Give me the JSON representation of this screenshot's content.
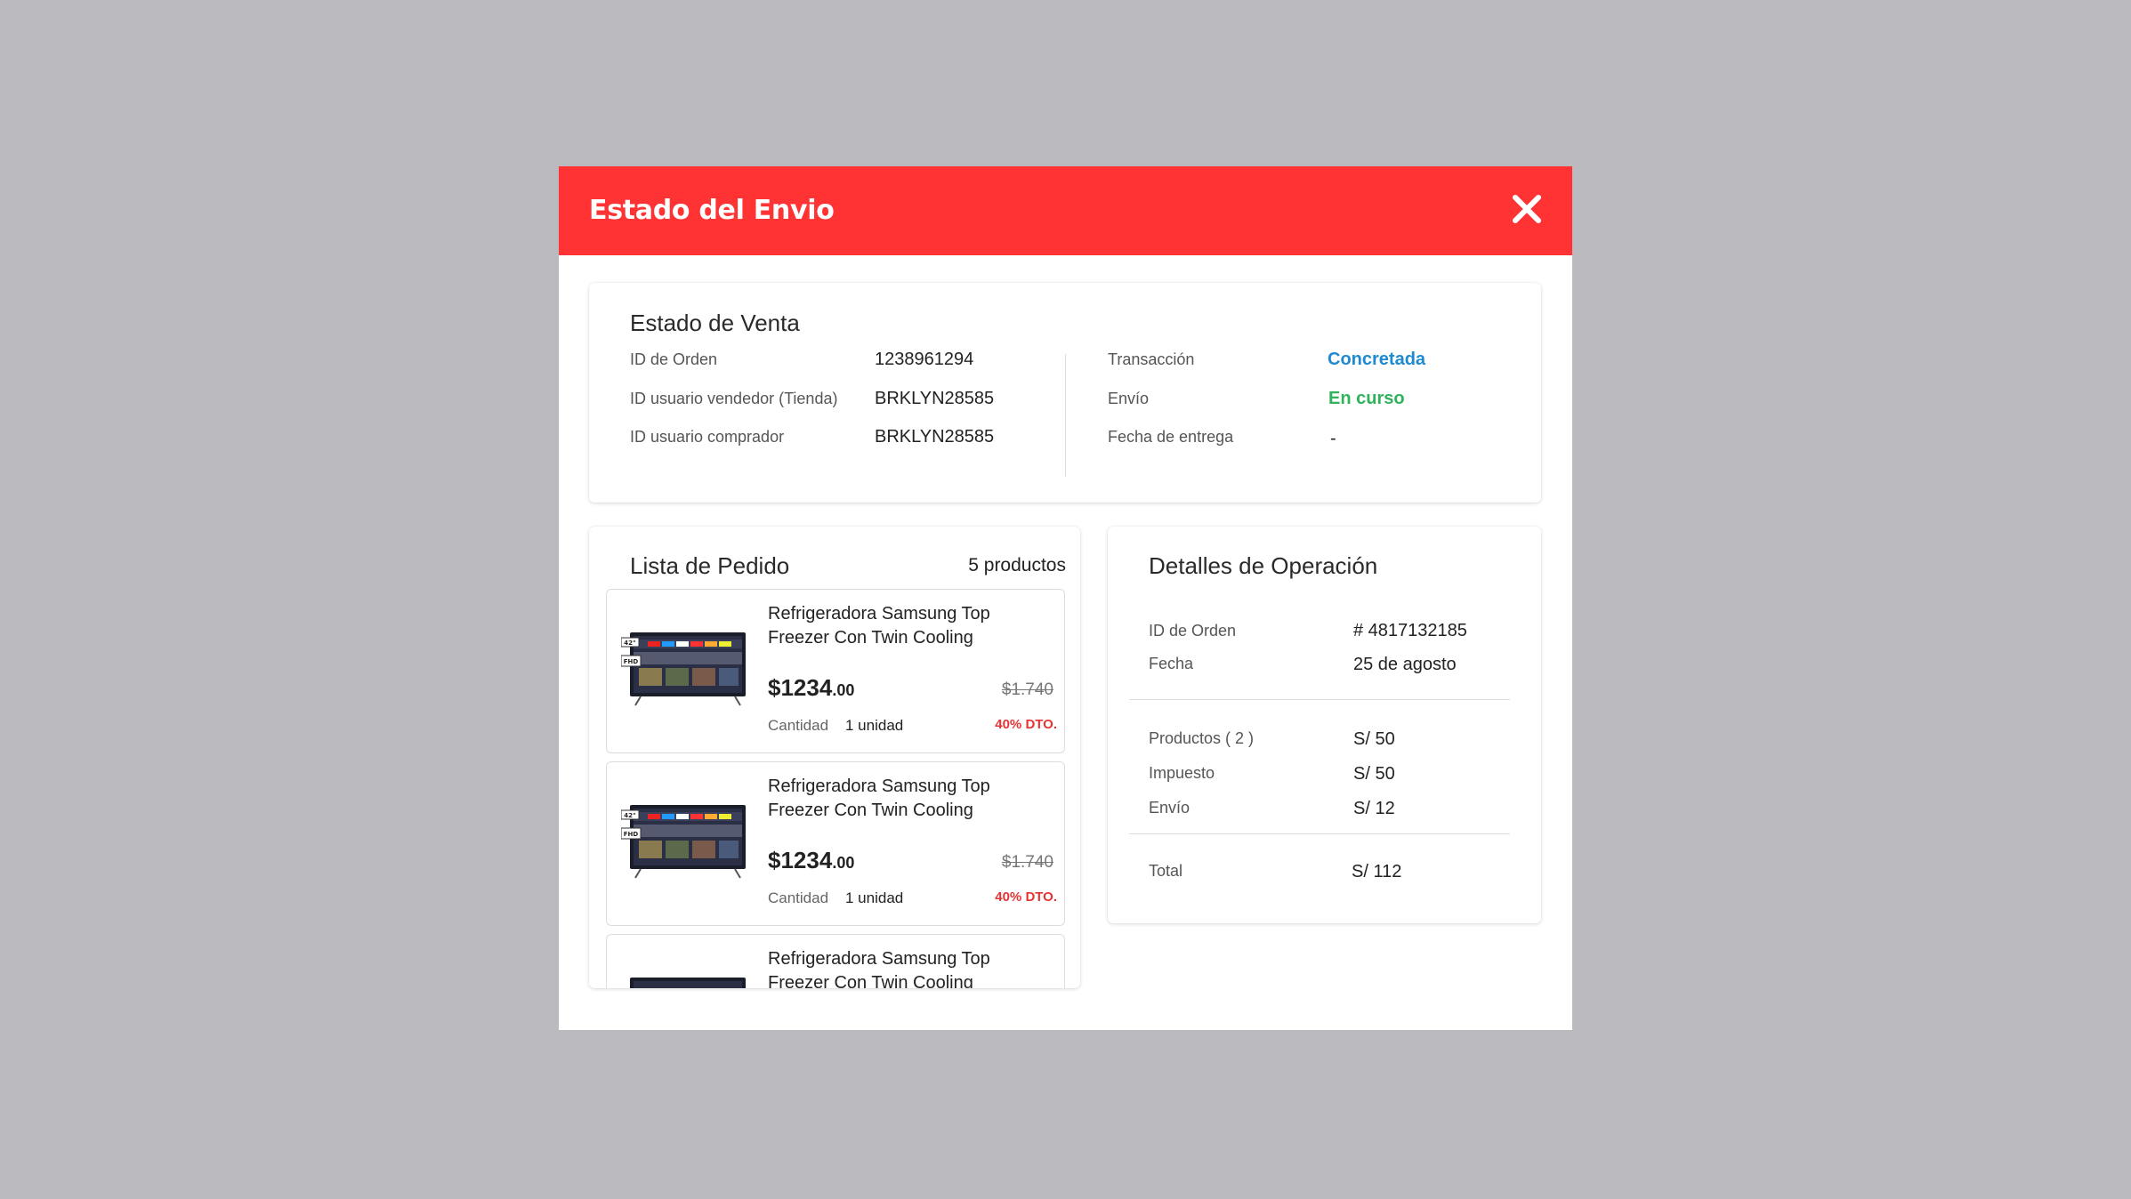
{
  "modal": {
    "title": "Estado del Envio",
    "close_icon": "close-icon"
  },
  "estado_venta": {
    "title": "Estado de Venta",
    "left": [
      {
        "label": "ID de Orden",
        "value": "1238961294"
      },
      {
        "label": "ID usuario vendedor (Tienda)",
        "value": "BRKLYN28585"
      },
      {
        "label": "ID usuario comprador",
        "value": "BRKLYN28585"
      }
    ],
    "right": [
      {
        "label": "Transacción",
        "value": "Concretada",
        "color": "#1e8ad0"
      },
      {
        "label": "Envío",
        "value": "En curso",
        "color": "#2fb35a"
      },
      {
        "label": "Fecha de entrega",
        "value": "-"
      }
    ]
  },
  "lista_pedido": {
    "title": "Lista de Pedido",
    "count": "5 productos",
    "items": [
      {
        "name": "Refrigeradora Samsung Top Freezer Con Twin Cooling",
        "price_int": "$1234",
        "price_dec": ".00",
        "old_price": "$1.740",
        "qty_label": "Cantidad",
        "qty_value": "1 unidad",
        "discount": "40% DTO."
      },
      {
        "name": "Refrigeradora Samsung Top Freezer Con Twin Cooling",
        "price_int": "$1234",
        "price_dec": ".00",
        "old_price": "$1.740",
        "qty_label": "Cantidad",
        "qty_value": "1 unidad",
        "discount": "40% DTO."
      },
      {
        "name": "Refrigeradora Samsung Top Freezer Con Twin Cooling"
      }
    ]
  },
  "detalles": {
    "title": "Detalles de Operación",
    "order": [
      {
        "label": "ID de Orden",
        "value": "# 4817132185"
      },
      {
        "label": "Fecha",
        "value": "25 de agosto"
      }
    ],
    "costs": [
      {
        "label": "Productos ( 2 )",
        "value": "S/ 50"
      },
      {
        "label": "Impuesto",
        "value": "S/ 50"
      },
      {
        "label": "Envío",
        "value": "S/ 12"
      }
    ],
    "total": {
      "label": "Total",
      "value": "S/ 112"
    }
  },
  "colors": {
    "header": "#ff3334",
    "backdrop": "#b9b9be",
    "accent_blue": "#1e8ad0",
    "accent_green": "#2fb35a",
    "discount_red": "#e53434"
  }
}
